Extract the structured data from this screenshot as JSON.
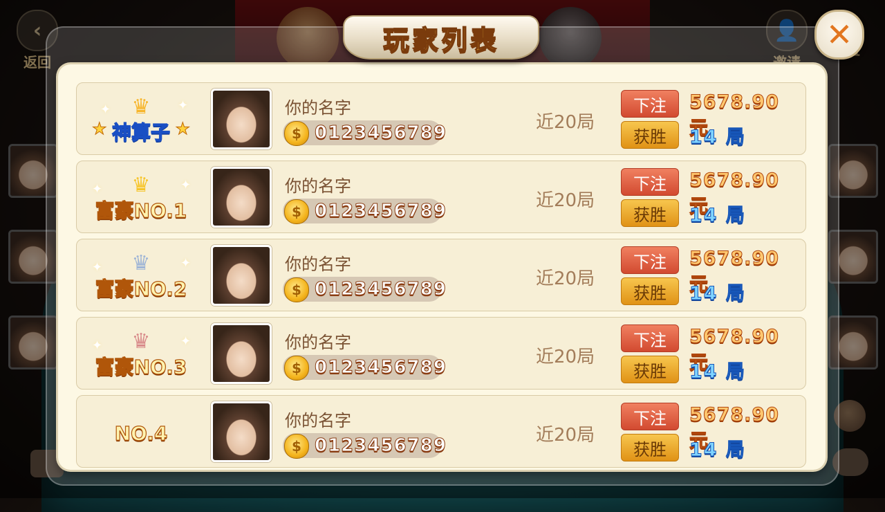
{
  "top_left": {
    "back_label": "返回",
    "icon": "back-chevron-icon"
  },
  "top_right": {
    "invite_label": "邀请",
    "settings_label_partial": "置",
    "icon": "invite-user-icon"
  },
  "modal": {
    "title": "玩家列表",
    "close_icon": "close-x-icon"
  },
  "players": [
    {
      "rank_label": "神算子",
      "rank_style": "blue",
      "crown": "gold",
      "name": "你的名字",
      "coins": "0123456789",
      "recent_label": "近20局",
      "bet_label": "下注",
      "bet_amount": "5678.90 元",
      "win_label": "获胜",
      "win_count": "14 局"
    },
    {
      "rank_label": "富豪NO.1",
      "rank_style": "gold",
      "crown": "gold",
      "name": "你的名字",
      "coins": "0123456789",
      "recent_label": "近20局",
      "bet_label": "下注",
      "bet_amount": "5678.90 元",
      "win_label": "获胜",
      "win_count": "14 局"
    },
    {
      "rank_label": "富豪NO.2",
      "rank_style": "gold",
      "crown": "silver",
      "name": "你的名字",
      "coins": "0123456789",
      "recent_label": "近20局",
      "bet_label": "下注",
      "bet_amount": "5678.90 元",
      "win_label": "获胜",
      "win_count": "14 局"
    },
    {
      "rank_label": "富豪NO.3",
      "rank_style": "gold",
      "crown": "bronze",
      "name": "你的名字",
      "coins": "0123456789",
      "recent_label": "近20局",
      "bet_label": "下注",
      "bet_amount": "5678.90 元",
      "win_label": "获胜",
      "win_count": "14 局"
    },
    {
      "rank_label": "NO.4",
      "rank_style": "gold",
      "crown": "none",
      "name": "你的名字",
      "coins": "0123456789",
      "recent_label": "近20局",
      "bet_label": "下注",
      "bet_amount": "5678.90 元",
      "win_label": "获胜",
      "win_count": "14 局"
    }
  ],
  "colors": {
    "title_gold": "#f2b53a",
    "bet_red": "#d24a30",
    "win_orange": "#e09216",
    "amount_orange": "#ffc870",
    "count_blue": "#7fd3ff",
    "close_orange": "#e2761f"
  }
}
